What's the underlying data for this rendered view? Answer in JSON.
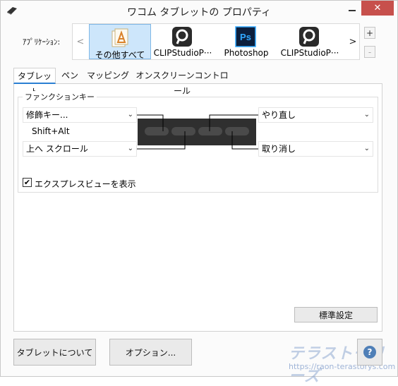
{
  "window": {
    "title": "ワコム タブレットの プロパティ"
  },
  "controls": {
    "minimize": "—",
    "close": "✕"
  },
  "applications": {
    "label": "ｱﾌﾟﾘｹｰｼｮﾝ:",
    "nav_prev": "<",
    "nav_next": ">",
    "add": "+",
    "remove": "-",
    "items": [
      {
        "label": "その他すべて",
        "icon": "all-apps-icon",
        "selected": true
      },
      {
        "label": "CLIPStudioP···",
        "icon": "clip-studio-icon",
        "selected": false
      },
      {
        "label": "Photoshop",
        "icon": "photoshop-icon",
        "selected": false
      },
      {
        "label": "CLIPStudioP···",
        "icon": "clip-studio-icon",
        "selected": false
      }
    ]
  },
  "tabs": [
    {
      "label": "タブレット",
      "active": true
    },
    {
      "label": "ペン",
      "active": false
    },
    {
      "label": "マッピング",
      "active": false
    },
    {
      "label": "オンスクリーンコントロール",
      "active": false
    }
  ],
  "function_keys": {
    "group_title": "ファンクションキー",
    "key1": "修飾キー...",
    "key1_sub": "Shift+Alt",
    "key2": "上へ スクロール",
    "key3": "やり直し",
    "key4": "取り消し",
    "chevron": "⌄"
  },
  "express_view": {
    "label": "エクスプレスビューを表示",
    "checked": true,
    "mark": "✔"
  },
  "buttons": {
    "default": "標準設定",
    "about": "タブレットについて",
    "options": "オプション...",
    "help": "?"
  },
  "watermark": {
    "logo": "テラストーリーズ",
    "url": "https://raon-terastorys.com"
  },
  "colors": {
    "accent": "#2b7fd3",
    "close_button": "#c7504c",
    "selected_tile": "#cde6fb",
    "clip_studio": "#2a2a2a",
    "photoshop_bg": "#0c1f3d",
    "photoshop_text": "#31a8ff"
  }
}
